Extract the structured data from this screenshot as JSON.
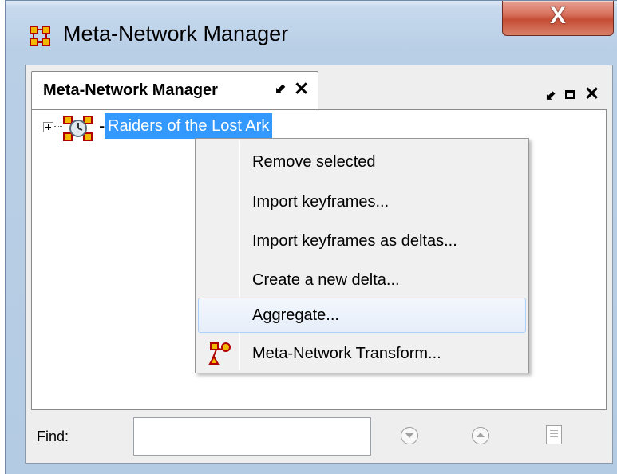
{
  "window": {
    "title": "Meta-Network Manager",
    "close_glyph": "X",
    "icon": "meta-network-icon"
  },
  "tab": {
    "label": "Meta-Network Manager",
    "pin_glyph": "⬋",
    "close_glyph": "✕"
  },
  "panel_controls": {
    "pin_glyph": "⬋",
    "close_glyph": "✕"
  },
  "tree": {
    "node_label": "Raiders of the Lost Ark",
    "node_icon": "meta-network-node-icon",
    "expander": "plus-box"
  },
  "context_menu": {
    "items": [
      {
        "label": "Remove selected"
      },
      {
        "label": "Import keyframes..."
      },
      {
        "label": "Import keyframes as deltas..."
      },
      {
        "label": "Create a new delta..."
      },
      {
        "label": "Aggregate..."
      },
      {
        "label": "Meta-Network Transform...",
        "icon": "transform-icon"
      }
    ],
    "hovered_index": 4
  },
  "find_bar": {
    "label": "Find:",
    "value": "",
    "placeholder": ""
  },
  "colors": {
    "selection": "#3399ff",
    "close_button": "#c54d35",
    "menu_hover_border": "#aecff7"
  }
}
